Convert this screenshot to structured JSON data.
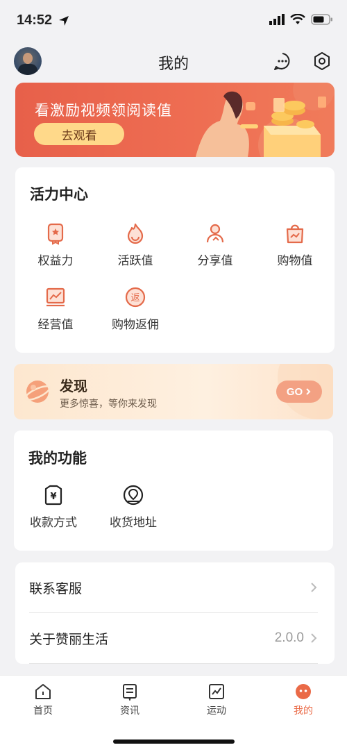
{
  "status_bar": {
    "time": "14:52"
  },
  "header": {
    "title": "我的"
  },
  "banner": {
    "text": "看激励视频领阅读值",
    "button_label": "去观看"
  },
  "activity_center": {
    "title": "活力中心",
    "items": [
      {
        "label": "权益力",
        "icon": "badge-icon"
      },
      {
        "label": "活跃值",
        "icon": "flame-icon"
      },
      {
        "label": "分享值",
        "icon": "person-share-icon"
      },
      {
        "label": "购物值",
        "icon": "shopping-bag-icon"
      },
      {
        "label": "经营值",
        "icon": "chart-board-icon"
      },
      {
        "label": "购物返佣",
        "icon": "rebate-icon"
      }
    ]
  },
  "discover": {
    "title": "发现",
    "subtitle": "更多惊喜，等你来发现",
    "button_label": "GO"
  },
  "my_functions": {
    "title": "我的功能",
    "items": [
      {
        "label": "收款方式",
        "icon": "yuan-wallet-icon"
      },
      {
        "label": "收货地址",
        "icon": "location-pin-icon"
      }
    ]
  },
  "settings_list": {
    "items": [
      {
        "label": "联系客服",
        "value": ""
      },
      {
        "label": "关于赞丽生活",
        "value": "2.0.0"
      }
    ]
  },
  "tabbar": {
    "tabs": [
      {
        "label": "首页",
        "icon": "home-icon",
        "active": false
      },
      {
        "label": "资讯",
        "icon": "news-icon",
        "active": false
      },
      {
        "label": "运动",
        "icon": "sport-chart-icon",
        "active": false
      },
      {
        "label": "我的",
        "icon": "profile-icon",
        "active": true
      }
    ]
  },
  "colors": {
    "accent": "#ea6a47",
    "banner": "#e7604a",
    "button_yellow": "#ffd98a",
    "go_button": "#f3a183"
  }
}
